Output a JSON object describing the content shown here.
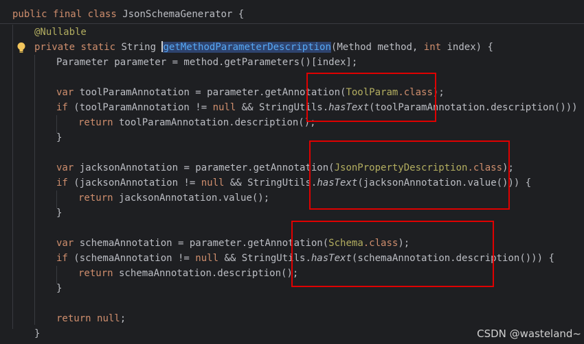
{
  "header": {
    "kw_public": "public",
    "kw_final": "final",
    "kw_class": "class",
    "class_name": "JsonSchemaGenerator",
    "brace": "{"
  },
  "code": {
    "annotation": "@Nullable",
    "sig_private": "private",
    "sig_static": "static",
    "sig_return": "String",
    "method_name": "getMethodParameterDescription",
    "sig_params_open": "(Method method, ",
    "sig_int": "int",
    "sig_params_close": " index) {",
    "line_parameter": "Parameter parameter = method.getParameters()[index];",
    "tool_var": "var",
    "tool_decl": " toolParamAnnotation = parameter.getAnnotation(",
    "tool_type": "ToolParam",
    "dot_class": ".class",
    "tool_decl_end": ");",
    "if_kw": "if",
    "tool_if_a": " (toolParamAnnotation != ",
    "null_kw": "null",
    "tool_if_b": " && StringUtils.",
    "has_text": "hasText",
    "tool_if_c": "(toolParamAnnotation.description())) {",
    "return_kw": "return",
    "tool_return": " toolParamAnnotation.description();",
    "close_brace": "}",
    "jackson_decl": " jacksonAnnotation = parameter.getAnnotation(",
    "jackson_type": "JsonPropertyDescription",
    "jackson_decl_end": ");",
    "jackson_if_a": " (jacksonAnnotation != ",
    "jackson_if_b": " && StringUtils.",
    "jackson_if_c": "(jacksonAnnotation.value())) {",
    "jackson_return": " jacksonAnnotation.value();",
    "schema_decl": " schemaAnnotation = parameter.getAnnotation(",
    "schema_type": "Schema",
    "schema_decl_end": ");",
    "schema_if_a": " (schemaAnnotation != ",
    "schema_if_b": " && StringUtils.",
    "schema_if_c": "(schemaAnnotation.description())) {",
    "schema_return": " schemaAnnotation.description();",
    "final_return_tail": ";",
    "method_close": "}"
  },
  "watermark": "CSDN @wasteland~",
  "colors": {
    "background": "#1e1f22",
    "keyword": "#cf8e6d",
    "annotation": "#b3ae60",
    "method_highlight": "#56a8f5",
    "highlight_box": "#e00000"
  },
  "icons": {
    "intention_bulb": "lightbulb-icon"
  }
}
